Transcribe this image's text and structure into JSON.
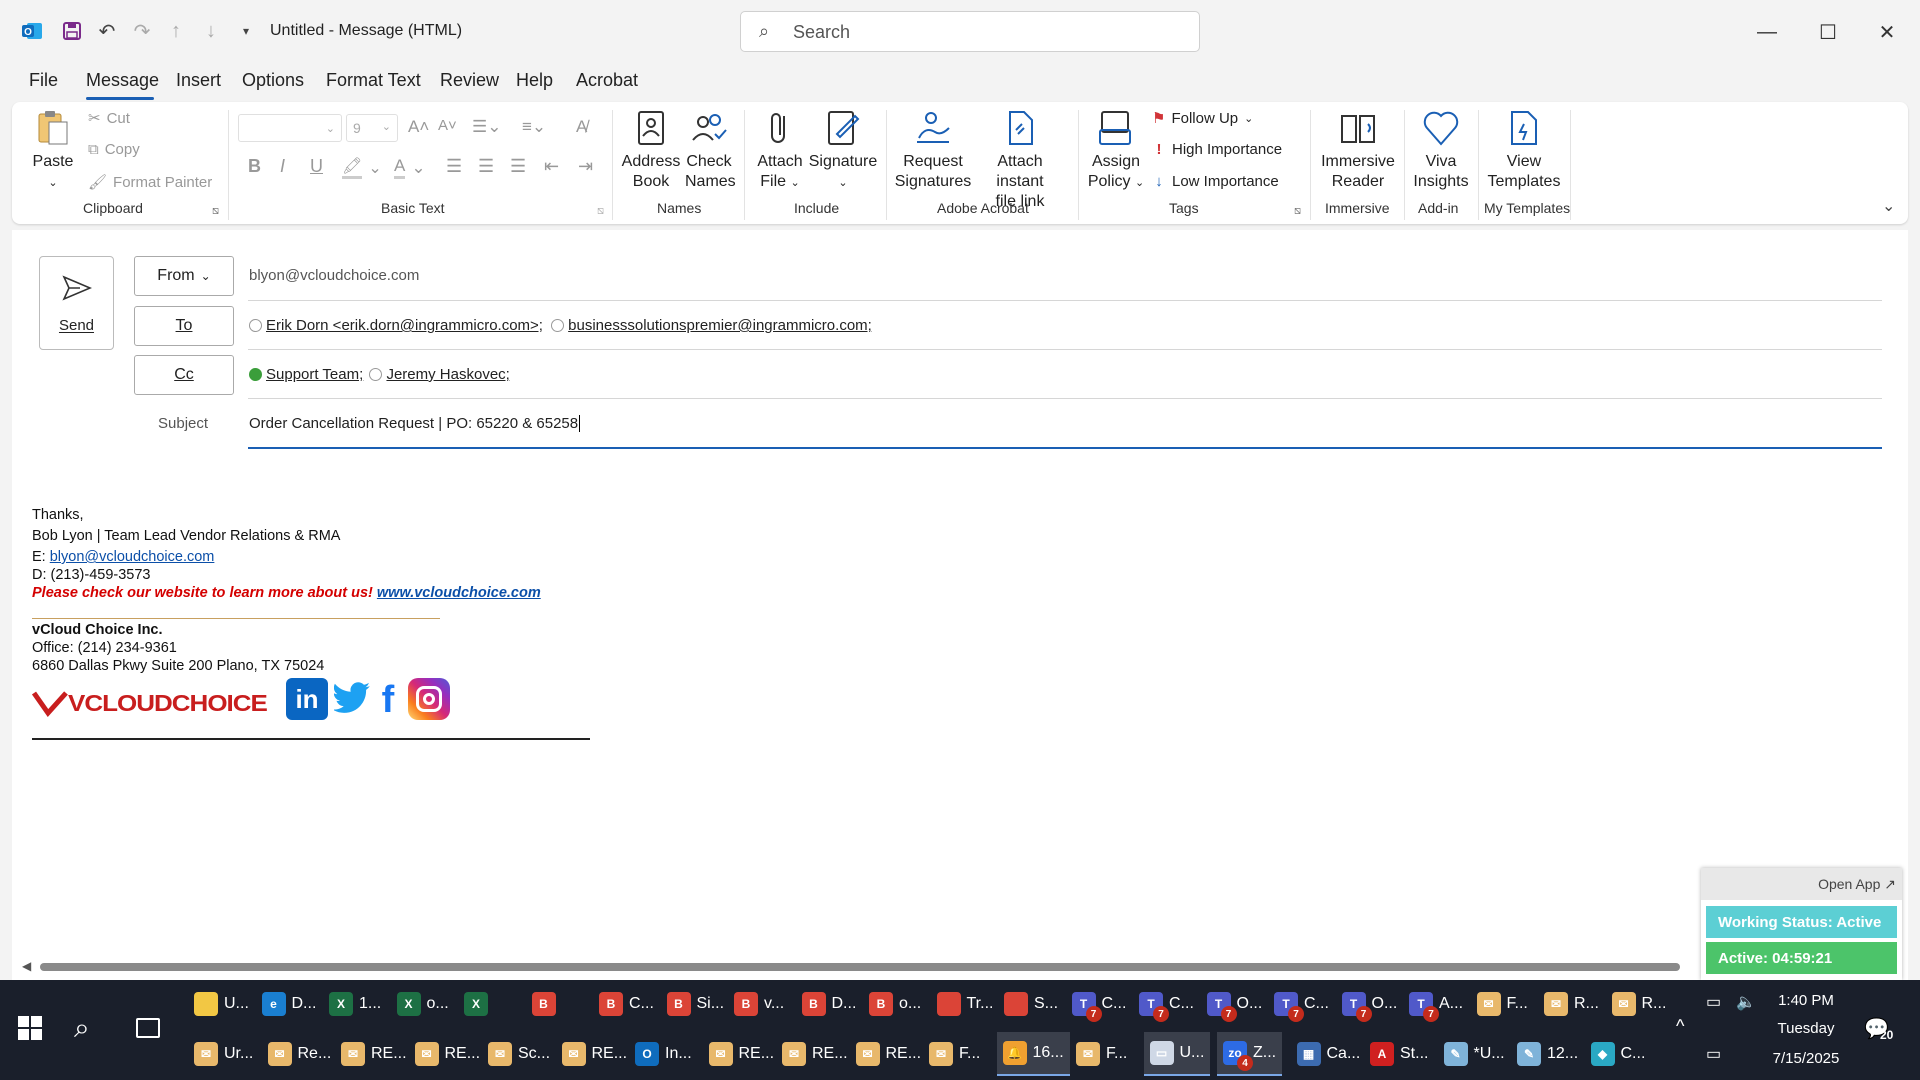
{
  "window": {
    "title": "Untitled  -  Message (HTML)",
    "search_placeholder": "Search"
  },
  "menu": [
    "File",
    "Message",
    "Insert",
    "Options",
    "Format Text",
    "Review",
    "Help",
    "Acrobat"
  ],
  "ribbon": {
    "clipboard": {
      "paste": "Paste",
      "cut": "Cut",
      "copy": "Copy",
      "format_painter": "Format Painter",
      "group": "Clipboard"
    },
    "basic_text": {
      "font_size": "9",
      "group": "Basic Text"
    },
    "names": {
      "address_book_1": "Address",
      "address_book_2": "Book",
      "check_names_1": "Check",
      "check_names_2": "Names",
      "group": "Names"
    },
    "include": {
      "attach_1": "Attach",
      "attach_2": "File",
      "signature": "Signature",
      "group": "Include"
    },
    "adobe": {
      "request_1": "Request",
      "request_2": "Signatures",
      "attach_link_1": "Attach instant",
      "attach_link_2": "file link",
      "group": "Adobe Acrobat"
    },
    "tags": {
      "assign_1": "Assign",
      "assign_2": "Policy",
      "follow_up": "Follow Up",
      "high": "High Importance",
      "low": "Low Importance",
      "group": "Tags"
    },
    "immersive": {
      "reader_1": "Immersive",
      "reader_2": "Reader",
      "group": "Immersive"
    },
    "addin": {
      "viva_1": "Viva",
      "viva_2": "Insights",
      "group": "Add-in"
    },
    "templates": {
      "view_1": "View",
      "view_2": "Templates",
      "group": "My Templates"
    }
  },
  "compose": {
    "send": "Send",
    "from_label": "From",
    "from_value": "blyon@vcloudchoice.com",
    "to_label": "To",
    "to_recipients": [
      "Erik Dorn <erik.dorn@ingrammicro.com>;",
      "businesssolutionspremier@ingrammicro.com;"
    ],
    "cc_label": "Cc",
    "cc_recipients": [
      "Support Team;",
      "Jeremy Haskovec;"
    ],
    "subject_label": "Subject",
    "subject_value": "Order Cancellation Request | PO: 65220 & 65258"
  },
  "signature": {
    "thanks": "Thanks,",
    "name_line": "Bob Lyon | Team Lead Vendor Relations & RMA",
    "email_prefix": "E: ",
    "email": "blyon@vcloudchoice.com",
    "phone": "D: (213)-459-3573",
    "promo": "Please check our website to learn more about us!",
    "website": "www.vcloudchoice.com",
    "company": "vCloud Choice Inc.",
    "office": "Office: (214) 234-9361",
    "address": "6860 Dallas Pkwy Suite 200 Plano, TX 75024",
    "logo_text": "VCLOUDCHOICE"
  },
  "widget": {
    "open_app": "Open App ↗",
    "status": "Working Status: Active",
    "active": "Active: 04:59:21"
  },
  "taskbar": {
    "row1": [
      {
        "label": "U...",
        "color": "#f2c744",
        "text": ""
      },
      {
        "label": "D...",
        "color": "#1a7fd1",
        "text": "e"
      },
      {
        "label": "1...",
        "color": "#1d7044",
        "text": "X"
      },
      {
        "label": "o...",
        "color": "#1d7044",
        "text": "X"
      },
      {
        "label": "",
        "color": "#1d7044",
        "text": "X"
      },
      {
        "label": "",
        "color": "#db4437",
        "text": "B"
      },
      {
        "label": "C...",
        "color": "#db4437",
        "text": "B"
      },
      {
        "label": "Si...",
        "color": "#db4437",
        "text": "B"
      },
      {
        "label": "v...",
        "color": "#db4437",
        "text": "B"
      },
      {
        "label": "D...",
        "color": "#db4437",
        "text": "B"
      },
      {
        "label": "o...",
        "color": "#db4437",
        "text": "B"
      },
      {
        "label": "Tr...",
        "color": "#db4437",
        "text": ""
      },
      {
        "label": "S...",
        "color": "#db4437",
        "text": ""
      },
      {
        "label": "C...",
        "color": "#5059c9",
        "text": "T",
        "badge": "7"
      },
      {
        "label": "C...",
        "color": "#5059c9",
        "text": "T",
        "badge": "7"
      },
      {
        "label": "O...",
        "color": "#5059c9",
        "text": "T",
        "badge": "7"
      },
      {
        "label": "C...",
        "color": "#5059c9",
        "text": "T",
        "badge": "7"
      },
      {
        "label": "O...",
        "color": "#5059c9",
        "text": "T",
        "badge": "7"
      },
      {
        "label": "A...",
        "color": "#5059c9",
        "text": "T",
        "badge": "7"
      },
      {
        "label": "F...",
        "color": "#e8b86b",
        "text": "✉"
      },
      {
        "label": "R...",
        "color": "#e8b86b",
        "text": "✉"
      },
      {
        "label": "R...",
        "color": "#e8b86b",
        "text": "✉"
      }
    ],
    "row2": [
      {
        "label": "Ur...",
        "color": "#e8b86b",
        "text": "✉"
      },
      {
        "label": "Re...",
        "color": "#e8b86b",
        "text": "✉"
      },
      {
        "label": "RE...",
        "color": "#e8b86b",
        "text": "✉"
      },
      {
        "label": "RE...",
        "color": "#e8b86b",
        "text": "✉"
      },
      {
        "label": "Sc...",
        "color": "#e8b86b",
        "text": "✉"
      },
      {
        "label": "RE...",
        "color": "#e8b86b",
        "text": "✉"
      },
      {
        "label": "In...",
        "color": "#0f6cbd",
        "text": "O"
      },
      {
        "label": "RE...",
        "color": "#e8b86b",
        "text": "✉"
      },
      {
        "label": "RE...",
        "color": "#e8b86b",
        "text": "✉"
      },
      {
        "label": "RE...",
        "color": "#e8b86b",
        "text": "✉"
      },
      {
        "label": "F...",
        "color": "#e8b86b",
        "text": "✉"
      },
      {
        "label": "16...",
        "color": "#f0a030",
        "text": "🔔",
        "active": true
      },
      {
        "label": "F...",
        "color": "#e8b86b",
        "text": "✉"
      },
      {
        "label": "U...",
        "color": "#cfd8e6",
        "text": "▭",
        "active": true
      },
      {
        "label": "Z...",
        "color": "#2d6be4",
        "text": "zo",
        "badge": "4",
        "active": true
      },
      {
        "label": "Ca...",
        "color": "#3c6bb0",
        "text": "▦"
      },
      {
        "label": "St...",
        "color": "#d02020",
        "text": "A"
      },
      {
        "label": "*U...",
        "color": "#7fb3d9",
        "text": "✎"
      },
      {
        "label": "12...",
        "color": "#7fb3d9",
        "text": "✎"
      },
      {
        "label": "C...",
        "color": "#2aa8c4",
        "text": "◆"
      }
    ],
    "time": "1:40 PM",
    "day": "Tuesday",
    "date": "7/15/2025",
    "notifications": "20"
  }
}
